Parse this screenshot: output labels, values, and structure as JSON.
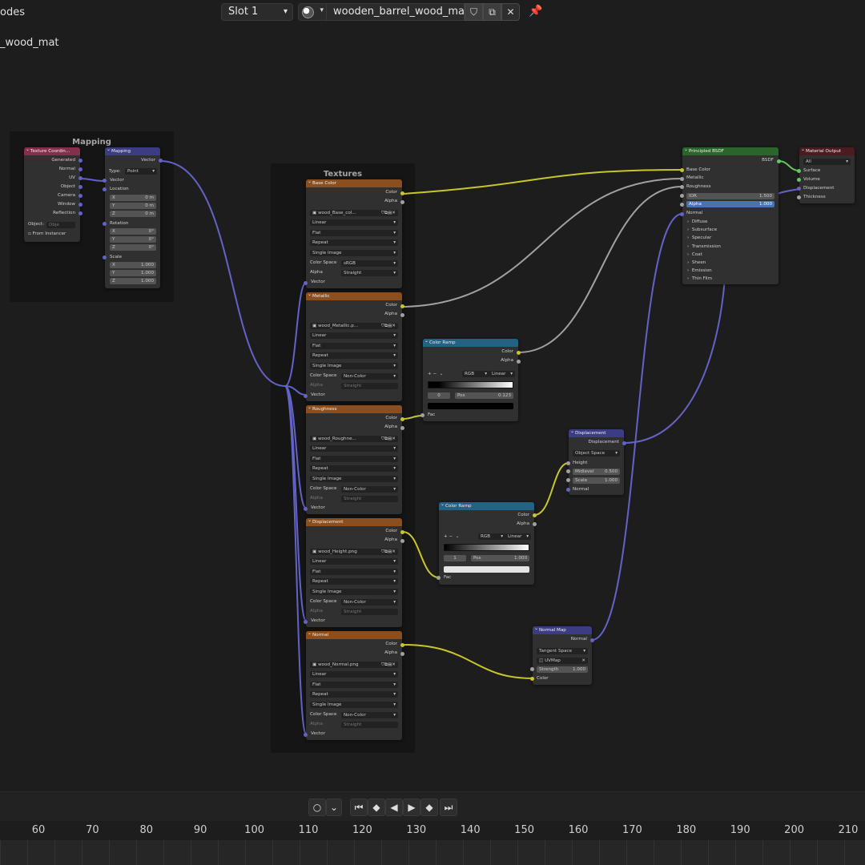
{
  "header": {
    "editor_title": "odes",
    "slot": "Slot 1",
    "material_name": "wooden_barrel_wood_mat",
    "breadcrumb": "_wood_mat"
  },
  "frames": {
    "mapping": "Mapping",
    "textures": "Textures"
  },
  "texcoord": {
    "title": "Texture Coordin...",
    "outputs": [
      "Generated",
      "Normal",
      "UV",
      "Object",
      "Camera",
      "Window",
      "Reflection"
    ],
    "object_label": "Object:",
    "object_placeholder": "Obje",
    "from_instancer": "From Instancer"
  },
  "mapping": {
    "title": "Mapping",
    "output": "Vector",
    "type_label": "Type:",
    "type_value": "Point",
    "vector": "Vector",
    "location": "Location",
    "rotation": "Rotation",
    "scale": "Scale",
    "x": "X",
    "y": "Y",
    "z": "Z",
    "loc_values": [
      "0 m",
      "0 m",
      "0 m"
    ],
    "rot_values": [
      "0°",
      "0°",
      "0°"
    ],
    "scale_values": [
      "1.000",
      "1.000",
      "1.000"
    ]
  },
  "texture_common": {
    "color": "Color",
    "alpha": "Alpha",
    "interp": "Linear",
    "proj": "Flat",
    "ext": "Repeat",
    "source": "Single Image",
    "color_space": "Color Space",
    "alpha_label": "Alpha",
    "alpha_mode": "Straight",
    "vector": "Vector"
  },
  "textures": [
    {
      "title": "Base Color",
      "file": "wood_Base_col...",
      "space": "sRGB"
    },
    {
      "title": "Metallic",
      "file": "wood_Metallic.p...",
      "space": "Non-Color"
    },
    {
      "title": "Roughness",
      "file": "wood_Roughne...",
      "space": "Non-Color"
    },
    {
      "title": "Displacement",
      "file": "wood_Height.png",
      "space": "Non-Color"
    },
    {
      "title": "Normal",
      "file": "wood_Normal.png",
      "space": "Non-Color"
    }
  ],
  "ramp1": {
    "title": "Color Ramp",
    "color": "Color",
    "alpha": "Alpha",
    "mode": "RGB",
    "interp": "Linear",
    "index": "0",
    "pos_label": "Pos",
    "pos": "0.123",
    "fac": "Fac"
  },
  "ramp2": {
    "title": "Color Ramp",
    "color": "Color",
    "alpha": "Alpha",
    "mode": "RGB",
    "interp": "Linear",
    "index": "1",
    "pos_label": "Pos",
    "pos": "1.000",
    "fac": "Fac"
  },
  "displacement": {
    "title": "Displacement",
    "output": "Displacement",
    "space": "Object Space",
    "height": "Height",
    "midlevel": "Midlevel",
    "midlevel_v": "0.500",
    "scale": "Scale",
    "scale_v": "1.000",
    "normal": "Normal"
  },
  "normalmap": {
    "title": "Normal Map",
    "output": "Normal",
    "space": "Tangent Space",
    "uv": "UVMap",
    "strength": "Strength",
    "strength_v": "1.000",
    "color": "Color"
  },
  "bsdf": {
    "title": "Principled BSDF",
    "output": "BSDF",
    "base_color": "Base Color",
    "metallic": "Metallic",
    "roughness": "Roughness",
    "ior": "IOR",
    "ior_v": "1.500",
    "alpha": "Alpha",
    "alpha_v": "1.000",
    "normal": "Normal",
    "panels": [
      "Diffuse",
      "Subsurface",
      "Specular",
      "Transmission",
      "Coat",
      "Sheen",
      "Emission",
      "Thin Film"
    ]
  },
  "output": {
    "title": "Material Output",
    "target": "All",
    "inputs": [
      "Surface",
      "Volume",
      "Displacement",
      "Thickness"
    ]
  },
  "timeline": {
    "frames": [
      "60",
      "70",
      "80",
      "90",
      "100",
      "110",
      "120",
      "130",
      "140",
      "150",
      "160",
      "170",
      "180",
      "190",
      "200",
      "210"
    ]
  },
  "colors": {
    "yellow_wire": "#c7c729",
    "gray_wire": "#a1a1a1",
    "vector_wire": "#6363c7",
    "shader_wire": "#63c763"
  }
}
